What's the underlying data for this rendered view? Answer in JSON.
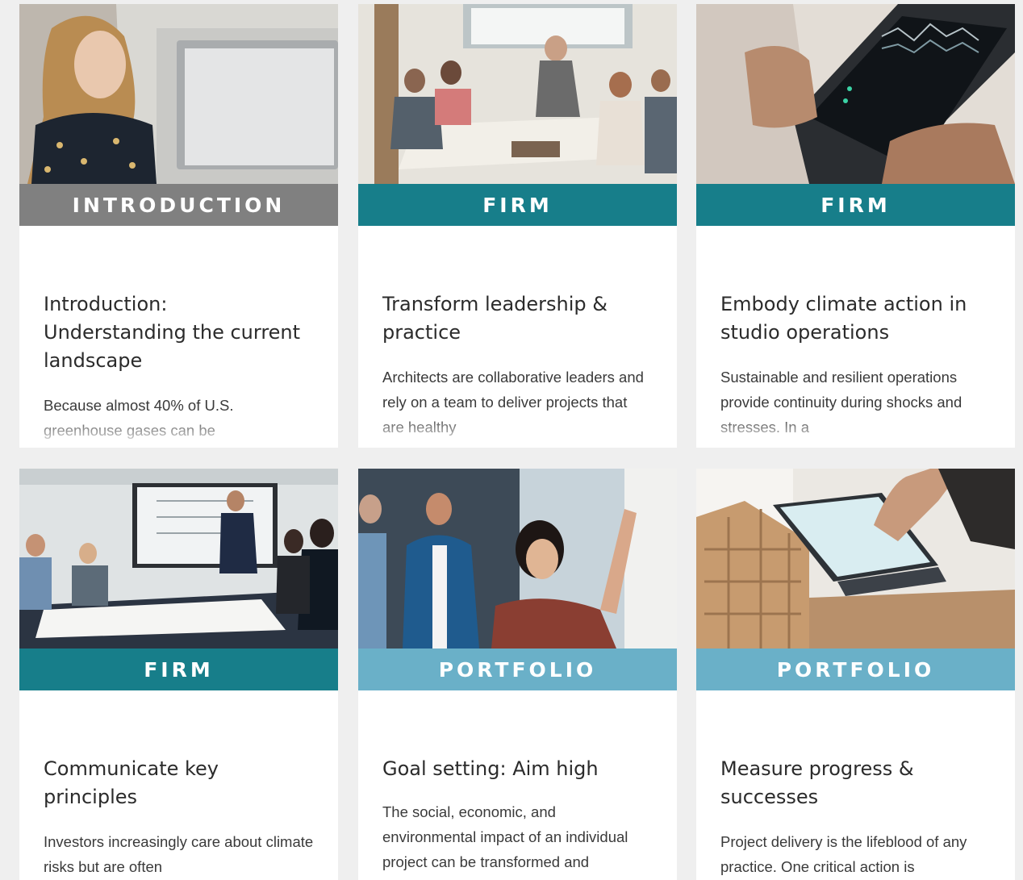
{
  "cards": [
    {
      "category": "INTRODUCTION",
      "category_color": "#808080",
      "image_subject": "woman at computer",
      "title": "Introduction: Understanding the current landscape",
      "excerpt": "Because almost 40% of U.S. greenhouse gases can be"
    },
    {
      "category": "FIRM",
      "category_color": "#177e8a",
      "image_subject": "team meeting at table",
      "title": "Transform leadership & practice",
      "excerpt": "Architects are collaborative leaders and rely on a team to deliver projects that are healthy"
    },
    {
      "category": "FIRM",
      "category_color": "#177e8a",
      "image_subject": "hands holding tablet with data",
      "title": "Embody climate action in studio operations",
      "excerpt": "Sustainable and resilient operations provide continuity during shocks and stresses. In a"
    },
    {
      "category": "FIRM",
      "category_color": "#177e8a",
      "image_subject": "presentation in conference room",
      "title": "Communicate key principles",
      "excerpt": "Investors increasingly care about climate risks but are often"
    },
    {
      "category": "PORTFOLIO",
      "category_color": "#6ab0c8",
      "image_subject": "woman writing on whiteboard",
      "title": "Goal setting: Aim high",
      "excerpt": "The social, economic, and environmental impact of an individual project can be transformed and amplified"
    },
    {
      "category": "PORTFOLIO",
      "category_color": "#6ab0c8",
      "image_subject": "architectural model and tablet",
      "title": "Measure progress & successes",
      "excerpt": "Project delivery is the lifeblood of any practice. One critical action is"
    }
  ]
}
